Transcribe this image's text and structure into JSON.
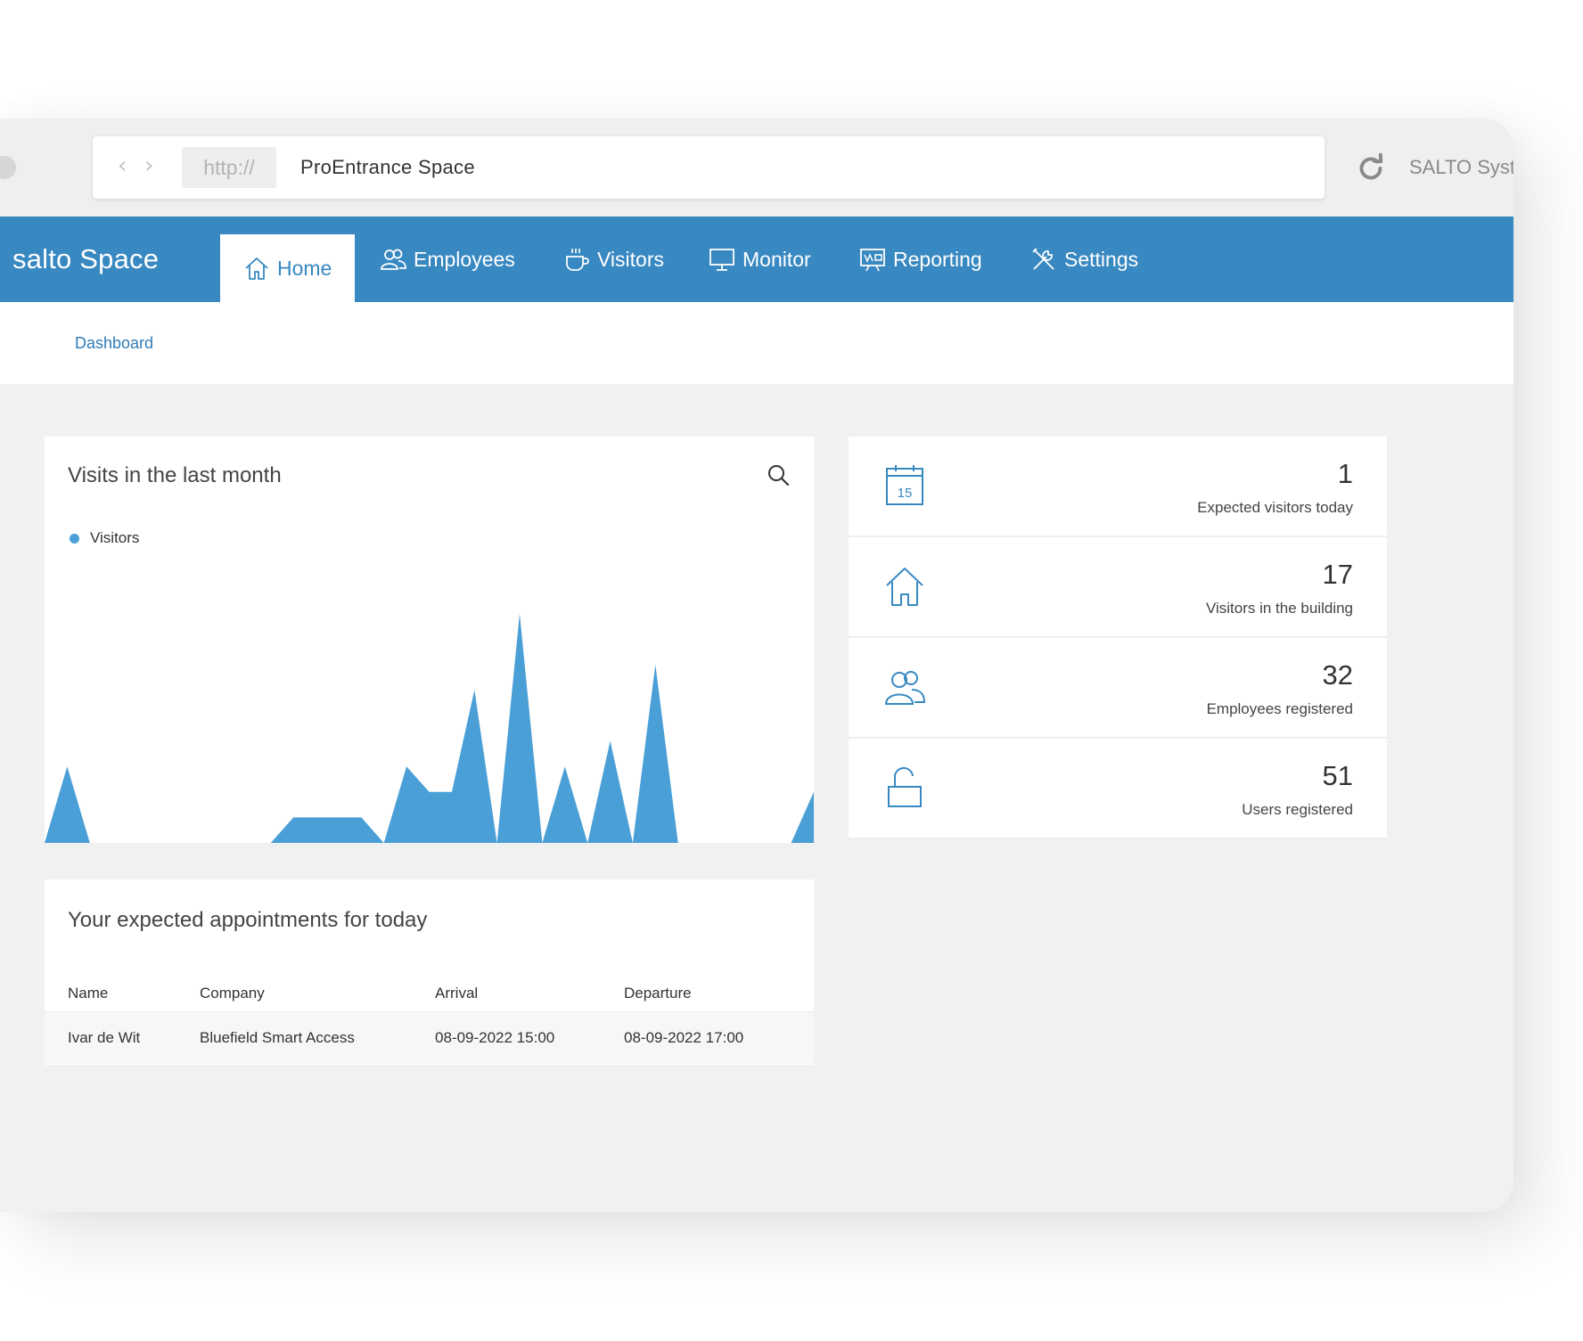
{
  "browser": {
    "protocol": "http://",
    "site_title": "ProEntrance Space",
    "right_label": "SALTO Syst",
    "back_glyph": "‹",
    "forward_glyph": "›",
    "reload_icon": "reload-icon"
  },
  "app": {
    "brand": "salto Space",
    "nav": [
      {
        "label": "Home",
        "icon": "home-icon",
        "active": true
      },
      {
        "label": "Employees",
        "icon": "users-icon",
        "active": false
      },
      {
        "label": "Visitors",
        "icon": "coffee-cup-icon",
        "active": false
      },
      {
        "label": "Monitor",
        "icon": "monitor-icon",
        "active": false
      },
      {
        "label": "Reporting",
        "icon": "report-icon",
        "active": false
      },
      {
        "label": "Settings",
        "icon": "tools-icon",
        "active": false
      }
    ],
    "breadcrumb": "Dashboard",
    "brand_color": "#3888c1"
  },
  "chart_card": {
    "title": "Visits in the last month",
    "search_icon": "search-icon"
  },
  "chart_data": {
    "type": "area",
    "title": "Visits in the last month",
    "series": [
      {
        "name": "Visitors",
        "color": "#4a9fd6",
        "values": [
          0,
          3,
          0,
          0,
          0,
          0,
          0,
          0,
          0,
          0,
          0,
          1,
          1,
          1,
          1,
          0,
          3,
          2,
          2,
          6,
          0,
          9,
          0,
          3,
          0,
          4,
          0,
          7,
          0,
          0,
          0,
          0,
          0,
          0,
          2
        ]
      }
    ],
    "ylim": [
      0,
      10
    ],
    "grid": false,
    "legend": "top-left"
  },
  "appointments": {
    "title": "Your expected appointments for today",
    "columns": [
      "Name",
      "Company",
      "Arrival",
      "Departure"
    ],
    "rows": [
      [
        "Ivar de Wit",
        "Bluefield Smart Access",
        "08-09-2022 15:00",
        "08-09-2022 17:00"
      ]
    ]
  },
  "stats": [
    {
      "value": "1",
      "label": "Expected visitors today",
      "icon": "calendar-icon"
    },
    {
      "value": "17",
      "label": "Visitors in the building",
      "icon": "home-icon"
    },
    {
      "value": "32",
      "label": "Employees registered",
      "icon": "users-icon"
    },
    {
      "value": "51",
      "label": "Users registered",
      "icon": "unlock-icon"
    }
  ]
}
